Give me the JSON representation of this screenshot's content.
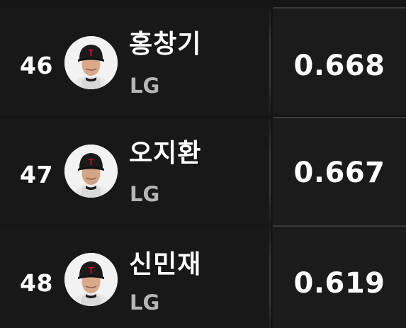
{
  "players": [
    {
      "rank": "46",
      "name": "홍창기",
      "team": "LG",
      "value": "0.668",
      "avatar_icon": "player-photo-icon"
    },
    {
      "rank": "47",
      "name": "오지환",
      "team": "LG",
      "value": "0.667",
      "avatar_icon": "player-photo-icon"
    },
    {
      "rank": "48",
      "name": "신민재",
      "team": "LG",
      "value": "0.619",
      "avatar_icon": "player-photo-icon"
    }
  ],
  "colors": {
    "background": "#151515",
    "text_primary": "#ffffff",
    "text_secondary": "#b5b5b5",
    "cap": "#1a1a1a",
    "cap_logo": "#c8102e"
  }
}
